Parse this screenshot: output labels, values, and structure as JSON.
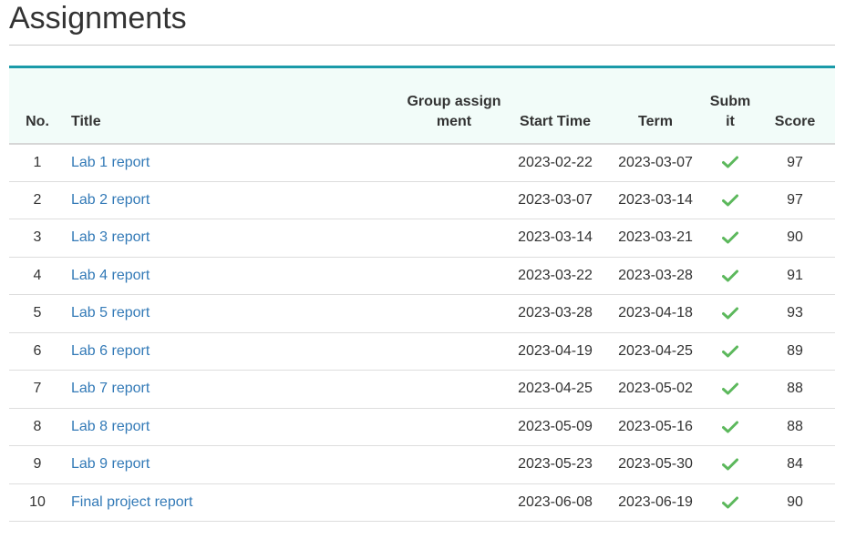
{
  "page": {
    "title": "Assignments"
  },
  "table": {
    "headers": {
      "no": "No.",
      "title": "Title",
      "group": "Group assignment",
      "start": "Start Time",
      "term": "Term",
      "submit": "Submit",
      "score": "Score"
    },
    "rows": [
      {
        "no": "1",
        "title": "Lab 1 report",
        "group": "",
        "start": "2023-02-22",
        "term": "2023-03-07",
        "submitted": true,
        "score": "97"
      },
      {
        "no": "2",
        "title": "Lab 2 report",
        "group": "",
        "start": "2023-03-07",
        "term": "2023-03-14",
        "submitted": true,
        "score": "97"
      },
      {
        "no": "3",
        "title": "Lab 3 report",
        "group": "",
        "start": "2023-03-14",
        "term": "2023-03-21",
        "submitted": true,
        "score": "90"
      },
      {
        "no": "4",
        "title": "Lab 4 report",
        "group": "",
        "start": "2023-03-22",
        "term": "2023-03-28",
        "submitted": true,
        "score": "91"
      },
      {
        "no": "5",
        "title": "Lab 5 report",
        "group": "",
        "start": "2023-03-28",
        "term": "2023-04-18",
        "submitted": true,
        "score": "93"
      },
      {
        "no": "6",
        "title": "Lab 6 report",
        "group": "",
        "start": "2023-04-19",
        "term": "2023-04-25",
        "submitted": true,
        "score": "89"
      },
      {
        "no": "7",
        "title": "Lab 7 report",
        "group": "",
        "start": "2023-04-25",
        "term": "2023-05-02",
        "submitted": true,
        "score": "88"
      },
      {
        "no": "8",
        "title": "Lab 8 report",
        "group": "",
        "start": "2023-05-09",
        "term": "2023-05-16",
        "submitted": true,
        "score": "88"
      },
      {
        "no": "9",
        "title": "Lab 9 report",
        "group": "",
        "start": "2023-05-23",
        "term": "2023-05-30",
        "submitted": true,
        "score": "84"
      },
      {
        "no": "10",
        "title": "Final project report",
        "group": "",
        "start": "2023-06-08",
        "term": "2023-06-19",
        "submitted": true,
        "score": "90"
      }
    ]
  },
  "icons": {
    "submitted": "check-icon"
  },
  "colors": {
    "accent_border": "#1a9aa8",
    "header_bg": "#f2fcf9",
    "link": "#337ab7",
    "check": "#5cb85c",
    "text": "#333333"
  }
}
